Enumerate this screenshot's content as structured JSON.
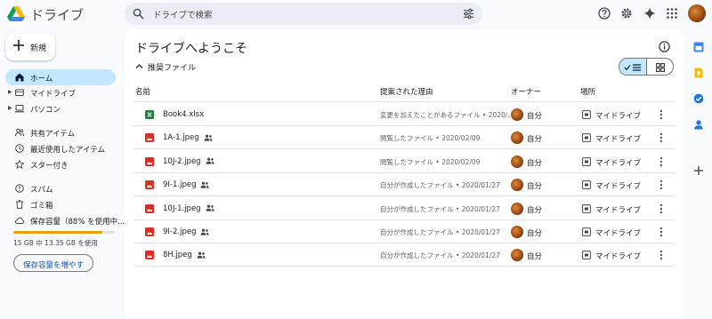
{
  "app": {
    "title": "ドライブ"
  },
  "search": {
    "placeholder": "ドライブで検索"
  },
  "sidebar": {
    "new_label": "新規",
    "items": [
      {
        "label": "ホーム",
        "icon": "home-icon",
        "active": true
      },
      {
        "label": "マイドライブ",
        "icon": "my-drive-icon",
        "caret": true
      },
      {
        "label": "パソコン",
        "icon": "computer-icon",
        "caret": true
      },
      {
        "label": "共有アイテム",
        "icon": "shared-icon"
      },
      {
        "label": "最近使用したアイテム",
        "icon": "clock-icon"
      },
      {
        "label": "スター付き",
        "icon": "star-icon"
      },
      {
        "label": "スパム",
        "icon": "spam-icon"
      },
      {
        "label": "ゴミ箱",
        "icon": "trash-icon"
      },
      {
        "label": "保存容量（88% を使用中...",
        "icon": "cloud-icon"
      }
    ],
    "storage": {
      "used_fraction": 0.88,
      "text": "15 GB 中 13.35 GB を使用",
      "bar_color": "#e3a008"
    },
    "buy_storage_label": "保存容量を増やす"
  },
  "main": {
    "title": "ドライブへようこそ",
    "section_label": "推奨ファイル",
    "columns": {
      "name": "名前",
      "reason": "提案された理由",
      "owner": "オーナー",
      "location": "場所"
    },
    "files": [
      {
        "name": "Book4.xlsx",
        "type": "sheet",
        "shared": false,
        "reason": "変更を加えたことがあるファイル • 2020/...",
        "owner": "自分",
        "location": "マイドライブ"
      },
      {
        "name": "1A-1.jpeg",
        "type": "image",
        "shared": true,
        "reason": "閲覧したファイル • 2020/02/09",
        "owner": "自分",
        "location": "マイドライブ"
      },
      {
        "name": "10J-2.jpeg",
        "type": "image",
        "shared": true,
        "reason": "閲覧したファイル • 2020/02/09",
        "owner": "自分",
        "location": "マイドライブ"
      },
      {
        "name": "9I-1.jpeg",
        "type": "image",
        "shared": true,
        "reason": "自分が作成したファイル • 2020/01/27",
        "owner": "自分",
        "location": "マイドライブ"
      },
      {
        "name": "10J-1.jpeg",
        "type": "image",
        "shared": true,
        "reason": "自分が作成したファイル • 2020/01/27",
        "owner": "自分",
        "location": "マイドライブ"
      },
      {
        "name": "9I-2.jpeg",
        "type": "image",
        "shared": true,
        "reason": "自分が作成したファイル • 2020/01/27",
        "owner": "自分",
        "location": "マイドライブ"
      },
      {
        "name": "8H.jpeg",
        "type": "image",
        "shared": true,
        "reason": "自分が作成したファイル • 2020/01/27",
        "owner": "自分",
        "location": "マイドライブ"
      }
    ]
  },
  "colors": {
    "accent": "#0b57d0",
    "active_bg": "#c2e7ff",
    "sheet": "#188038",
    "image": "#d93025"
  }
}
